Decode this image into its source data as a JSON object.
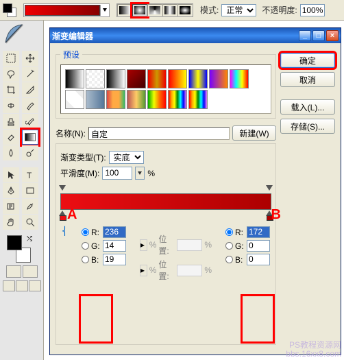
{
  "topbar": {
    "mode_label": "模式:",
    "mode_value": "正常",
    "opacity_label": "不透明度:",
    "opacity_value": "100%",
    "gradient_types": [
      "linear",
      "radial",
      "angle",
      "reflected",
      "diamond"
    ],
    "active_gradient_type": "radial"
  },
  "dialog": {
    "title": "渐变编辑器",
    "presets_label": "预设",
    "name_label": "名称(N):",
    "name_value": "自定",
    "new_btn": "新建(W)",
    "buttons": {
      "ok": "确定",
      "cancel": "取消",
      "load": "载入(L)...",
      "save": "存储(S)..."
    },
    "grad_type_label": "渐变类型(T):",
    "grad_type_value": "实底",
    "smooth_label": "平滑度(M):",
    "smooth_value": "100",
    "smooth_unit": "%",
    "position_label": "位置:",
    "rgb_labels": {
      "r": "R:",
      "g": "G:",
      "b": "B:"
    },
    "stopA": {
      "r": "236",
      "g": "14",
      "b": "19"
    },
    "stopB": {
      "r": "172",
      "g": "0",
      "b": "0"
    },
    "ann_a": "A",
    "ann_b": "B"
  },
  "watermark": {
    "l1": "PS教程资源网",
    "l2": "bbs.16xx8.com"
  },
  "chart_data": {
    "type": "gradient",
    "stops": [
      {
        "position": 0,
        "color": {
          "r": 236,
          "g": 14,
          "b": 19
        }
      },
      {
        "position": 100,
        "color": {
          "r": 172,
          "g": 0,
          "b": 0
        }
      }
    ],
    "opacity_stops": [
      {
        "position": 0,
        "opacity": 100
      },
      {
        "position": 100,
        "opacity": 100
      }
    ]
  }
}
